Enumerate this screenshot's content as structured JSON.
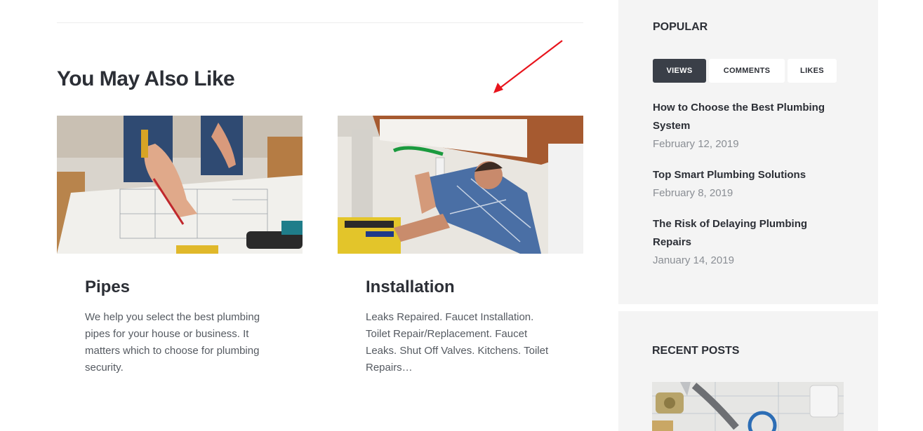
{
  "related": {
    "heading": "You May Also Like",
    "cards": [
      {
        "title": "Pipes",
        "text": "We help you select the best plumbing pipes for your house or business. It matters which to choose for plumbing security.",
        "image": "plumber-drawing-blueprint-photo"
      },
      {
        "title": "Installation",
        "text": "Leaks Repaired. Faucet Installation. Toilet Repair/Replacement. Faucet Leaks. Shut Off Valves. Kitchens. Toilet Repairs…",
        "image": "plumber-under-sink-photo"
      }
    ]
  },
  "sidebar": {
    "popular": {
      "title": "POPULAR",
      "tabs": [
        "VIEWS",
        "COMMENTS",
        "LIKES"
      ],
      "active_tab": "VIEWS",
      "posts": [
        {
          "title": "How to Choose the Best Plumbing System",
          "date": "February 12, 2019"
        },
        {
          "title": "Top Smart Plumbing Solutions",
          "date": "February 8, 2019"
        },
        {
          "title": "The Risk of Delaying Plumbing Repairs",
          "date": "January 14, 2019"
        }
      ]
    },
    "recent": {
      "title": "RECENT POSTS",
      "image": "plumbing-tools-on-blueprint-photo"
    }
  },
  "colors": {
    "text_dark": "#2c2f36",
    "text_muted": "#555a61",
    "date": "#8a8e94",
    "sidebar_bg": "#f4f4f4",
    "tab_active_bg": "#3a3f48",
    "annotation_arrow": "#e8141c"
  }
}
